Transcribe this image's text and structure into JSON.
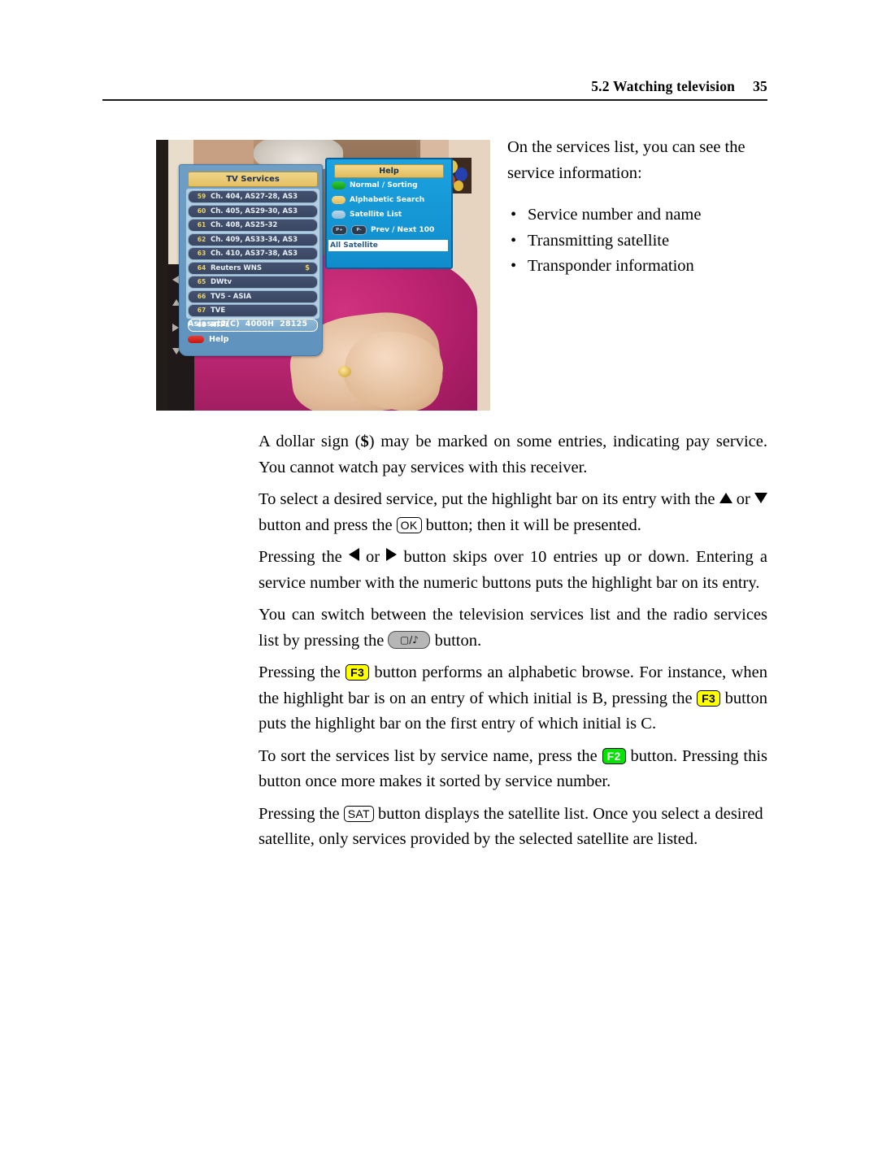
{
  "header": {
    "section": "5.2 Watching television",
    "page_number": "35"
  },
  "figure": {
    "alt_name": "tv-services-osd-screenshot",
    "osd": {
      "tv_panel": {
        "title": "TV Services",
        "services": [
          {
            "number": "59",
            "name": "Ch. 404, AS27-28, AS3",
            "pay": "",
            "selected": false
          },
          {
            "number": "60",
            "name": "Ch. 405, AS29-30, AS3",
            "pay": "",
            "selected": false
          },
          {
            "number": "61",
            "name": "Ch. 408, AS25-32",
            "pay": "",
            "selected": false
          },
          {
            "number": "62",
            "name": "Ch. 409,  AS33-34, AS3",
            "pay": "",
            "selected": false
          },
          {
            "number": "63",
            "name": "Ch. 410, AS37-38, AS3",
            "pay": "",
            "selected": false
          },
          {
            "number": "64",
            "name": "Reuters WNS",
            "pay": "$",
            "selected": false
          },
          {
            "number": "65",
            "name": "DWtv",
            "pay": "",
            "selected": false
          },
          {
            "number": "66",
            "name": "TV5 - ASIA",
            "pay": "",
            "selected": false
          },
          {
            "number": "67",
            "name": "TVE",
            "pay": "",
            "selected": false
          },
          {
            "number": "68",
            "name": "RTPi",
            "pay": "",
            "selected": true
          }
        ],
        "satellite": "Asiasat2(C)",
        "frequency": "4000H",
        "symbol_rate": "28125",
        "help_label": "Help"
      },
      "help_panel": {
        "title": "Help",
        "items": [
          {
            "key": "green",
            "label": "Normal  /  Sorting"
          },
          {
            "key": "yellow",
            "label": "Alphabetic Search"
          },
          {
            "key": "blue",
            "label": "Satellite List"
          },
          {
            "key": "page",
            "key_left": "P+",
            "key_right": "P-",
            "label": "Prev / Next 100"
          }
        ],
        "satellite_filter": "All Satellite"
      }
    }
  },
  "sidebar_text": {
    "intro": "On the services list, you can see the service information:",
    "bullets": [
      "Service number and name",
      "Transmitting satellite",
      "Transponder information"
    ]
  },
  "paragraphs": {
    "p1_a": "A dollar sign (",
    "p1_dollar": "$",
    "p1_b": ") may be marked on some entries, indicating pay service. You cannot watch pay services with this receiver.",
    "p2_a": "To select a desired service, put the highlight bar on its entry with the",
    "p2_b": "or",
    "p2_c": "button and press the",
    "p2_ok": "OK",
    "p2_d": "button; then it will be presented.",
    "p3_a": "Pressing the",
    "p3_b": "or",
    "p3_c": "button skips over 10 entries up or down. Entering a service number with the numeric buttons puts the highlight bar on its entry.",
    "p4_a": "You can switch between the television services list and the radio services list by pressing the",
    "p4_b": "button.",
    "p5_a": "Pressing the",
    "p5_f3_1": "F3",
    "p5_b": "button performs an alphabetic browse.  For instance, when the highlight bar is on an entry of which initial is B, pressing the",
    "p5_f3_2": "F3",
    "p5_c": "button puts the highlight bar on the first entry of which initial is C.",
    "p6_a": "To sort the services list by service name, press the",
    "p6_f2": "F2",
    "p6_b": "button.  Pressing this button once more makes it sorted by service number.",
    "p7_a": "Pressing the",
    "p7_sat": "SAT",
    "p7_b": "button displays the satellite list.   Once you select a desired satellite, only services provided by the selected satellite are listed."
  },
  "colors": {
    "f3_key_bg": "#ffff00",
    "f2_key_bg": "#00e400",
    "osd_title_bg": "#e3bf62",
    "osd_panel_bg": "#5f93bd",
    "help_panel_bg": "#0f8ccb",
    "red_key": "#c01710"
  }
}
